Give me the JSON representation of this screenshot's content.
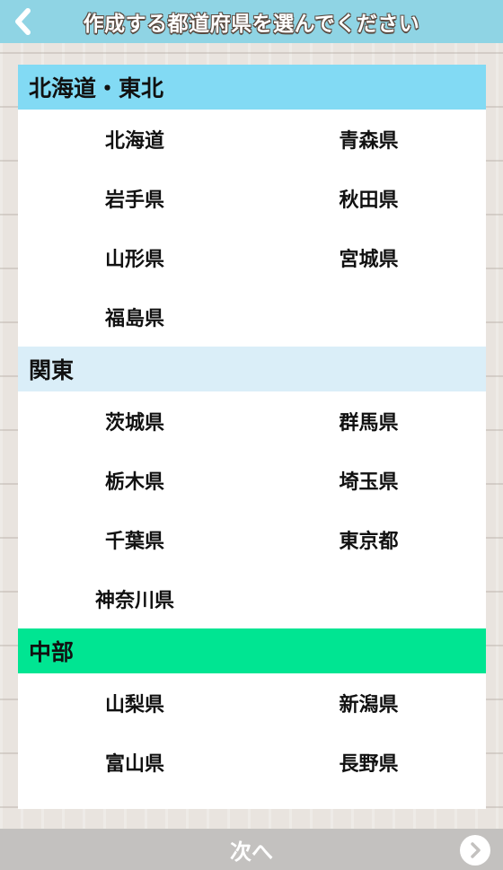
{
  "header": {
    "title": "作成する都道府県を選んでください",
    "back_icon": "chevron-left-icon"
  },
  "sections": [
    {
      "name": "北海道・東北",
      "color": "#82daf4",
      "prefectures": [
        "北海道",
        "青森県",
        "岩手県",
        "秋田県",
        "山形県",
        "宮城県",
        "福島県"
      ]
    },
    {
      "name": "関東",
      "color": "#daeef8",
      "prefectures": [
        "茨城県",
        "群馬県",
        "栃木県",
        "埼玉県",
        "千葉県",
        "東京都",
        "神奈川県"
      ]
    },
    {
      "name": "中部",
      "color": "#00e592",
      "prefectures": [
        "山梨県",
        "新潟県",
        "富山県",
        "長野県"
      ]
    }
  ],
  "footer": {
    "next_label": "次へ",
    "next_icon": "chevron-right-icon"
  }
}
